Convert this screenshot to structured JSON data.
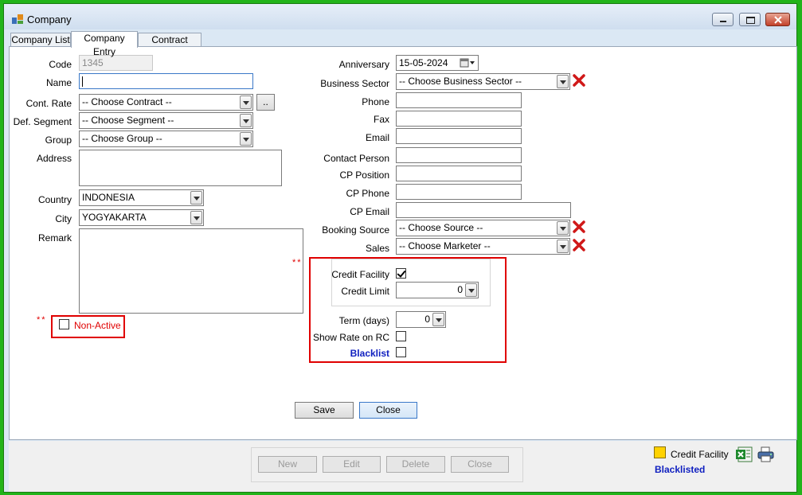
{
  "window": {
    "title": "Company"
  },
  "tabs": [
    "Company List",
    "Company Entry",
    "Contract Detail"
  ],
  "form": {
    "code": {
      "label": "Code",
      "value": "1345"
    },
    "name": {
      "label": "Name",
      "value": ""
    },
    "cont_rate": {
      "label": "Cont. Rate",
      "value": "-- Choose Contract --",
      "browse": ".."
    },
    "def_segment": {
      "label": "Def. Segment",
      "value": "-- Choose Segment --"
    },
    "group": {
      "label": "Group",
      "value": "-- Choose Group --"
    },
    "address": {
      "label": "Address",
      "value": ""
    },
    "country": {
      "label": "Country",
      "value": "INDONESIA"
    },
    "city": {
      "label": "City",
      "value": "YOGYAKARTA"
    },
    "remark": {
      "label": "Remark",
      "value": ""
    },
    "non_active": {
      "label": "Non-Active",
      "checked": false
    },
    "anniversary": {
      "label": "Anniversary",
      "value": "15-05-2024"
    },
    "business_sector": {
      "label": "Business Sector",
      "value": "-- Choose Business Sector --"
    },
    "phone": {
      "label": "Phone",
      "value": ""
    },
    "fax": {
      "label": "Fax",
      "value": ""
    },
    "email": {
      "label": "Email",
      "value": ""
    },
    "contact_person": {
      "label": "Contact Person",
      "value": ""
    },
    "cp_position": {
      "label": "CP Position",
      "value": ""
    },
    "cp_phone": {
      "label": "CP Phone",
      "value": ""
    },
    "cp_email": {
      "label": "CP Email",
      "value": ""
    },
    "booking_source": {
      "label": "Booking Source",
      "value": "-- Choose Source --"
    },
    "sales": {
      "label": "Sales",
      "value": "-- Choose Marketer --"
    },
    "credit_facility": {
      "label": "Credit Facility",
      "checked": true
    },
    "credit_limit": {
      "label": "Credit Limit",
      "value": "0"
    },
    "term_days": {
      "label": "Term (days)",
      "value": "0"
    },
    "show_rate_on_rc": {
      "label": "Show Rate on RC",
      "checked": false
    },
    "blacklist": {
      "label": "Blacklist",
      "checked": false
    },
    "required_marker": "**"
  },
  "actions": {
    "save": "Save",
    "close": "Close"
  },
  "toolbar": {
    "new": "New",
    "edit": "Edit",
    "delete": "Delete",
    "close": "Close"
  },
  "legend": {
    "credit_facility": "Credit Facility",
    "blacklisted": "Blacklisted"
  },
  "colors": {
    "accent": "#e00000",
    "blacklist_text": "#1020c0",
    "credit_swatch": "#ffd200"
  },
  "icons": [
    "app-icon",
    "calendar-icon",
    "delete-x-icon",
    "excel-icon",
    "print-icon"
  ]
}
